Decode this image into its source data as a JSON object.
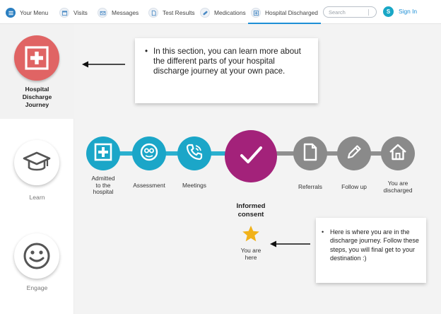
{
  "nav": {
    "items": [
      {
        "label": "Your Menu",
        "icon": "menu-icon"
      },
      {
        "label": "Visits",
        "icon": "calendar-icon"
      },
      {
        "label": "Messages",
        "icon": "envelope-icon"
      },
      {
        "label": "Test Results",
        "icon": "document-icon"
      },
      {
        "label": "Medications",
        "icon": "pill-icon"
      },
      {
        "label": "Hospital Discharged",
        "icon": "plus-box-icon",
        "active": true
      }
    ],
    "search_placeholder": "Search",
    "avatar_initial": "S",
    "signin_label": "Sign In"
  },
  "sidebar": {
    "items": [
      {
        "label": "Hospital Discharge Journey",
        "icon": "plus-box-icon",
        "active": true
      },
      {
        "label": "Learn",
        "icon": "graduation-cap-icon"
      },
      {
        "label": "Engage",
        "icon": "smiley-icon"
      }
    ]
  },
  "callouts": {
    "top": "In this section, you can learn more about the different parts of your hospital discharge journey at your own pace.",
    "bottom": "Here is where you are in the discharge journey. Follow these steps,  you will final get to your destination :)"
  },
  "journey": {
    "steps": [
      {
        "label": "Admitted to the hospital",
        "icon": "plus-box-icon",
        "status": "completed"
      },
      {
        "label": "Assessment",
        "icon": "stethoscope-face-icon",
        "status": "completed"
      },
      {
        "label": "Meetings",
        "icon": "phone-icon",
        "status": "completed"
      },
      {
        "label": "Informed consent",
        "icon": "checkmark-icon",
        "status": "current"
      },
      {
        "label": "Referrals",
        "icon": "document-icon",
        "status": "upcoming"
      },
      {
        "label": "Follow up",
        "icon": "pencil-icon",
        "status": "upcoming"
      },
      {
        "label": "You are discharged",
        "icon": "home-icon",
        "status": "upcoming"
      }
    ],
    "you_are_here": "You are here",
    "marker_icon": "star-icon"
  },
  "colors": {
    "completed": "#1ba6c8",
    "current": "#a3227a",
    "upcoming": "#8a8a8a",
    "track_completed": "#2bb0cf",
    "track_upcoming": "#8f8f8f",
    "accent": "#1e8fd6",
    "sidebar_active_circle": "#e06464",
    "star": "#f1b21a"
  }
}
